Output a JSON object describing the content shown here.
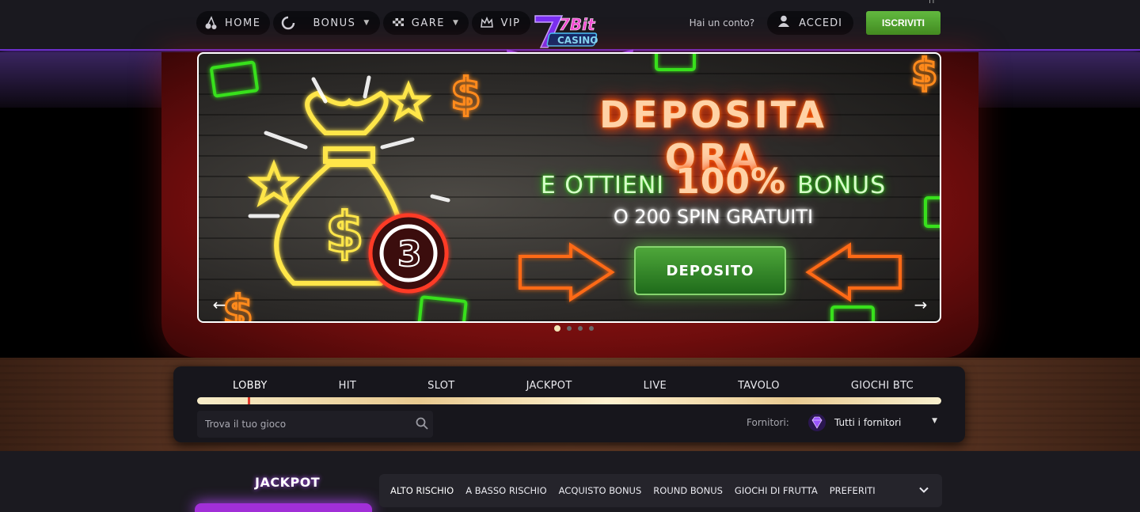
{
  "header": {
    "nav": [
      {
        "label": "HOME",
        "icon": "cherry-icon"
      },
      {
        "label": "BONUS",
        "icon": "spinner-icon",
        "dropdown": true
      },
      {
        "label": "GARE",
        "icon": "checkered-flag-icon",
        "dropdown": true
      },
      {
        "label": "VIP",
        "icon": "crown-icon"
      }
    ],
    "logo": {
      "top": "7Bit",
      "bottom": "CASINO"
    },
    "account_question": "Hai un conto?",
    "login_label": "ACCEDI",
    "signup_label": "ISCRIVITI",
    "language_fragment": "IT"
  },
  "banner": {
    "title": "DEPOSITA ORA",
    "subtitle_prefix": "E OTTIENI",
    "subtitle_highlight": "100%",
    "subtitle_suffix": "BONUS",
    "spins": "O 200 SPIN GRATUITI",
    "cta_label": "DEPOSITO",
    "coin_number": "3",
    "prev_arrow": "←",
    "next_arrow": "→",
    "slides_total": 4,
    "slide_active": 1
  },
  "games": {
    "categories": [
      "LOBBY",
      "HIT",
      "SLOT",
      "JACKPOT",
      "LIVE",
      "TAVOLO",
      "GIOCHI BTC"
    ],
    "active_category": "LOBBY",
    "search": {
      "placeholder": "Trova il tuo gioco",
      "value": ""
    },
    "providers_label": "Fornitori:",
    "providers_value": "Tutti i fornitori"
  },
  "lower": {
    "jackpot_title": "JACKPOT",
    "filters": [
      "ALTO RISCHIO",
      "A BASSO RISCHIO",
      "ACQUISTO BONUS",
      "ROUND BONUS",
      "GIOCHI DI FRUTTA",
      "PREFERITI"
    ]
  },
  "colors": {
    "accent_green": "#4fa82f",
    "header_purple": "#6b2fc9",
    "neon_orange": "#ff4a00",
    "neon_green": "#38e01b"
  }
}
